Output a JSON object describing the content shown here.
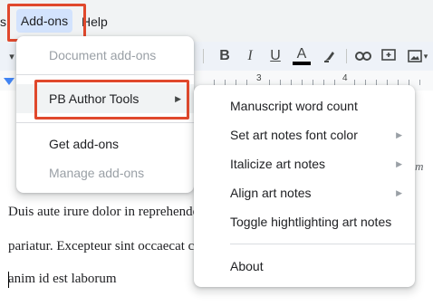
{
  "menubar": {
    "partial_item": "s",
    "addons_label": "Add-ons",
    "help_label": "Help"
  },
  "toolbar": {
    "icons": [
      "chevron-down-icon",
      "bold-icon",
      "italic-icon",
      "underline-icon",
      "text-color-icon",
      "highlight-icon",
      "link-icon",
      "comment-icon",
      "image-icon"
    ],
    "bold_label": "B",
    "italic_label": "I",
    "underline_label": "U",
    "text_color_label": "A",
    "text_color": "#000000"
  },
  "ruler": {
    "numbers": [
      "3",
      "4"
    ]
  },
  "document": {
    "line1": "Duis aute irure dolor in reprehenderit in voluptate velit esse cillum dolore",
    "line2": "pariatur. Excepteur sint occaecat cupidatat non proident, sunt in culpa qui",
    "line3": "anim id est laborum",
    "right_fragment": "Nam"
  },
  "addons_menu": {
    "items": [
      {
        "label": "Document add-ons",
        "enabled": false
      },
      {
        "label": "PB Author Tools",
        "enabled": true,
        "has_submenu": true,
        "highlighted": true
      },
      {
        "label": "Get add-ons",
        "enabled": true
      },
      {
        "label": "Manage add-ons",
        "enabled": false
      }
    ]
  },
  "pb_submenu": {
    "items": [
      {
        "label": "Manuscript word count",
        "has_submenu": false
      },
      {
        "label": "Set art notes font color",
        "has_submenu": true
      },
      {
        "label": "Italicize art notes",
        "has_submenu": true
      },
      {
        "label": "Align art notes",
        "has_submenu": true
      },
      {
        "label": "Toggle hightlighting art notes",
        "has_submenu": false
      },
      {
        "label": "About",
        "has_submenu": false
      }
    ]
  },
  "colors": {
    "highlight_box": "#e0482c",
    "menu_active": "#d3e3fd",
    "ruler_marker": "#4285f4"
  }
}
